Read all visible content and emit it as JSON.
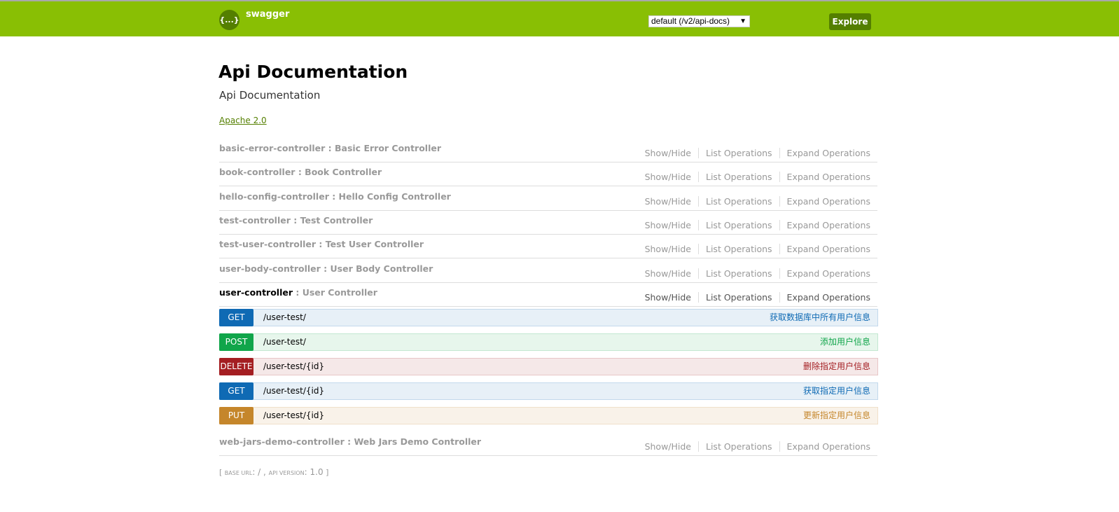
{
  "header": {
    "brand": "swagger",
    "logo_icon": "swagger-logo-icon",
    "logo_text": "{...}",
    "spec_select": "default (/v2/api-docs)",
    "explore_label": "Explore",
    "color": "#89bf04"
  },
  "info": {
    "title": "Api Documentation",
    "description": "Api Documentation",
    "license": "Apache 2.0"
  },
  "ops_labels": {
    "show_hide": "Show/Hide",
    "list": "List Operations",
    "expand": "Expand Operations"
  },
  "resources": [
    {
      "id": "basic-error-controller",
      "desc": " : Basic Error Controller"
    },
    {
      "id": "book-controller",
      "desc": " : Book Controller"
    },
    {
      "id": "hello-config-controller",
      "desc": " : Hello Config Controller"
    },
    {
      "id": "test-controller",
      "desc": " : Test Controller"
    },
    {
      "id": "test-user-controller",
      "desc": " : Test User Controller"
    },
    {
      "id": "user-body-controller",
      "desc": " : User Body Controller"
    },
    {
      "id": "user-controller",
      "desc": " : User Controller",
      "open": true
    },
    {
      "id": "web-jars-demo-controller",
      "desc": " : Web Jars Demo Controller"
    }
  ],
  "endpoints": [
    {
      "method": "GET",
      "path": "/user-test/",
      "summary": "获取数据库中所有用户信息",
      "color": "#0f6ab4",
      "bg": "#e7f0f7",
      "border": "#c3d9ec"
    },
    {
      "method": "POST",
      "path": "/user-test/",
      "summary": "添加用户信息",
      "color": "#10a54a",
      "bg": "#e7f6ec",
      "border": "#c3e8d1"
    },
    {
      "method": "DELETE",
      "path": "/user-test/{id}",
      "summary": "删除指定用户信息",
      "color": "#a41e22",
      "bg": "#f5e8e8",
      "border": "#e8c6c7"
    },
    {
      "method": "GET",
      "path": "/user-test/{id}",
      "summary": "获取指定用户信息",
      "color": "#0f6ab4",
      "bg": "#e7f0f7",
      "border": "#c3d9ec"
    },
    {
      "method": "PUT",
      "path": "/user-test/{id}",
      "summary": "更新指定用户信息",
      "color": "#c5862b",
      "bg": "#f9f2e9",
      "border": "#f0e0ca"
    }
  ],
  "footer": {
    "open": "[ ",
    "base_url_label": "base url",
    "base_url": ": / , ",
    "api_version_label": "api version",
    "api_version": ": 1.0",
    "close": " ]"
  }
}
